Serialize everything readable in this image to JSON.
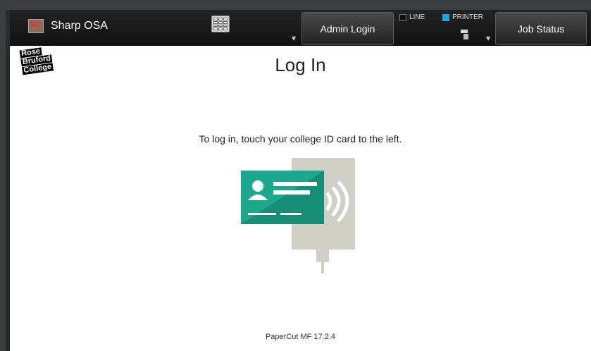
{
  "app": {
    "title": "Sharp OSA"
  },
  "topbar": {
    "admin_login_label": "Admin Login",
    "job_status_label": "Job Status",
    "line_toggle": {
      "label": "LINE",
      "checked": false
    },
    "printer_toggle": {
      "label": "PRINTER",
      "checked": true,
      "color": "#1aa4e6"
    }
  },
  "logo": {
    "lines": [
      "Rose",
      "Bruford",
      "College"
    ]
  },
  "main": {
    "title": "Log In",
    "instruction": "To log in, touch your college ID card to the left.",
    "version": "PaperCut MF 17.2.4"
  },
  "icons": [
    "app-icon",
    "keypad-icon",
    "printer-icon",
    "id-card-icon",
    "card-reader-icon"
  ],
  "colors": {
    "card": "#1ca88c",
    "reader": "#cfcfc6",
    "accent": "#1aa4e6"
  }
}
